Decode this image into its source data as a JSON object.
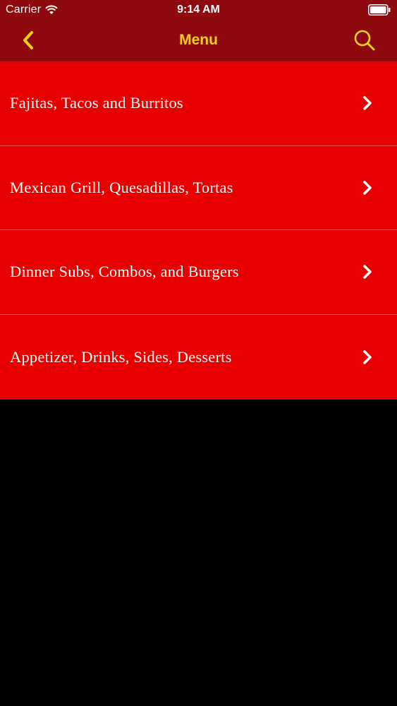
{
  "status_bar": {
    "carrier": "Carrier",
    "time": "9:14 AM",
    "wifi_icon": "wifi-icon",
    "battery_icon": "battery-icon"
  },
  "nav": {
    "title": "Menu",
    "back_icon": "chevron-left-icon",
    "search_icon": "search-icon"
  },
  "menu": {
    "items": [
      {
        "label": "Fajitas, Tacos and Burritos"
      },
      {
        "label": "Mexican Grill, Quesadillas, Tortas"
      },
      {
        "label": "Dinner Subs, Combos, and Burgers"
      },
      {
        "label": "Appetizer, Drinks, Sides, Desserts"
      }
    ],
    "row_icon": "chevron-right-icon"
  },
  "colors": {
    "nav_background": "#8f0a0e",
    "accent_yellow": "#f2d11d",
    "row_background": "#e60000",
    "row_separator": "#f05a5a",
    "empty_background": "#000000",
    "text": "#ffffff"
  }
}
